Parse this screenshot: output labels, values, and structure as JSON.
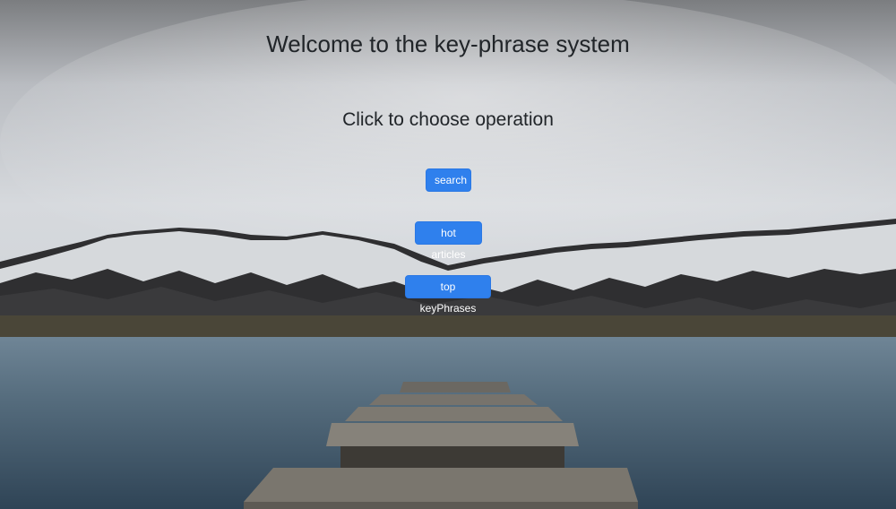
{
  "page": {
    "heading": "Welcome to the key-phrase system",
    "subheading": "Click to choose operation"
  },
  "buttons": {
    "search_label": "search",
    "hot_articles_label": "hot articles",
    "top_keyphrases_label": "top keyPhrases"
  },
  "colors": {
    "button_primary": "#2f80ed",
    "heading_text": "#212529"
  }
}
